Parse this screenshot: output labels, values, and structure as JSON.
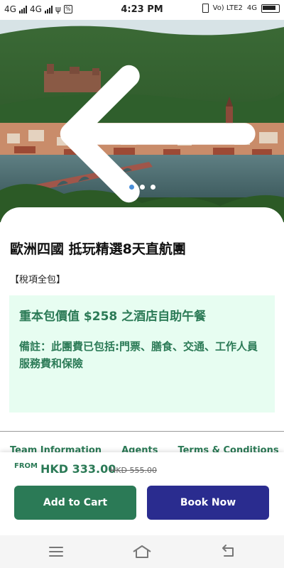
{
  "status_bar": {
    "left_network_1": "4G",
    "left_network_2": "4G",
    "time": "4:23 PM",
    "right_network": "Vo) LTE2",
    "right_4g": "4G"
  },
  "hero": {
    "carousel_dots": 3,
    "active_dot": 0
  },
  "tour": {
    "title": "歐洲四國 抵玩精選8天直航團",
    "tax_note": "【稅項全包】",
    "promo_headline": "重本包價值 $258 之酒店自助午餐",
    "promo_note": "備註：此團費已包括:門票、膳食、交通、工作人員服務費和保險"
  },
  "tabs": [
    "Team Information",
    "Agents",
    "Terms & Conditions"
  ],
  "pricing": {
    "from_label": "FROM",
    "price": "HKD 333.00",
    "original_price": "HKD 555.00"
  },
  "actions": {
    "add_to_cart": "Add to Cart",
    "book_now": "Book Now"
  },
  "colors": {
    "brand_green": "#2b7a56",
    "brand_navy": "#2a2c8f",
    "promo_bg": "#e7fdf1",
    "active_dot": "#4a8fd9"
  },
  "icons": {
    "back": "arrow-left-icon",
    "cart": "shopping-cart-icon",
    "nav_menu": "menu-icon",
    "nav_home": "home-icon",
    "nav_back": "back-icon"
  }
}
